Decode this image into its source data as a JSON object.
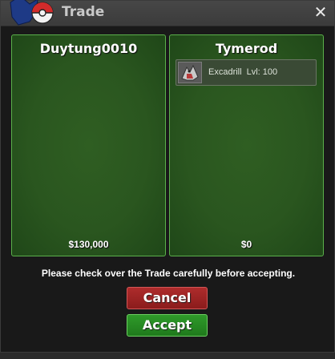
{
  "window": {
    "title": "Trade",
    "close_symbol": "✕"
  },
  "left_panel": {
    "player_name": "Duytung0010",
    "money": "$130,000"
  },
  "right_panel": {
    "player_name": "Tymerod",
    "money": "$0",
    "items": [
      {
        "name": "Excadrill",
        "level": "Lvl: 100",
        "icon": "excadrill-icon"
      }
    ]
  },
  "notice_text": "Please check over the Trade carefully before accepting.",
  "buttons": {
    "cancel_label": "Cancel",
    "accept_label": "Accept"
  },
  "colors": {
    "panel_green": "#2a561f",
    "cancel_red": "#9c2424",
    "accept_green": "#268a22"
  }
}
